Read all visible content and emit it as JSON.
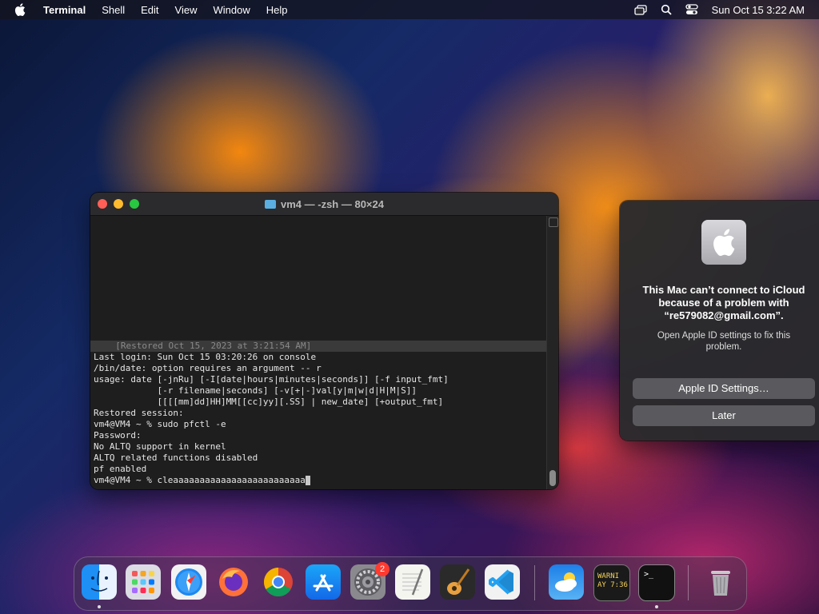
{
  "menubar": {
    "app_name": "Terminal",
    "items": [
      "Shell",
      "Edit",
      "View",
      "Window",
      "Help"
    ],
    "clock": "Sun Oct 15  3:22 AM"
  },
  "terminal": {
    "title": "vm4 — -zsh — 80×24",
    "lines": [
      "  [Restored Oct 15, 2023 at 3:21:54 AM]",
      "Last login: Sun Oct 15 03:20:26 on console",
      "/bin/date: option requires an argument -- r",
      "usage: date [-jnRu] [-I[date|hours|minutes|seconds]] [-f input_fmt]",
      "            [-r filename|seconds] [-v[+|-]val[y|m|w|d|H|M|S]]",
      "            [[[[mm]dd]HH]MM[[cc]yy][.SS] | new_date] [+output_fmt]",
      "Restored session:",
      "vm4@VM4 ~ % sudo pfctl -e",
      "Password:",
      "No ALTQ support in kernel",
      "ALTQ related functions disabled",
      "pf enabled"
    ],
    "prompt_line": "vm4@VM4 ~ % cleaaaaaaaaaaaaaaaaaaaaaaaaa"
  },
  "alert": {
    "title": "This Mac can’t connect to iCloud because of a problem with “re579082@gmail.com”.",
    "message": "Open Apple ID settings to fix this problem.",
    "primary_button": "Apple ID Settings…",
    "secondary_button": "Later"
  },
  "dock": {
    "items": [
      {
        "name": "finder-icon",
        "app": "Finder"
      },
      {
        "name": "launchpad-icon",
        "app": "Launchpad"
      },
      {
        "name": "safari-icon",
        "app": "Safari"
      },
      {
        "name": "firefox-icon",
        "app": "Firefox"
      },
      {
        "name": "chrome-icon",
        "app": "Chrome"
      },
      {
        "name": "app-store-icon",
        "app": "App Store"
      },
      {
        "name": "system-settings-icon",
        "app": "System Settings"
      },
      {
        "name": "textedit-icon",
        "app": "TextEdit"
      },
      {
        "name": "garageband-icon",
        "app": "GarageBand"
      },
      {
        "name": "vscode-icon",
        "app": "Visual Studio Code"
      },
      {
        "name": "weather-icon",
        "app": "Weather"
      },
      {
        "name": "console-icon",
        "app": "Console"
      },
      {
        "name": "terminal-icon",
        "app": "Terminal"
      },
      {
        "name": "trash-icon",
        "app": "Trash"
      }
    ],
    "settings_badge": "2",
    "console_text_1": "WARNI",
    "console_text_2": "AY 7:36",
    "terminal_prompt": ">_"
  },
  "colors": {
    "close": "#ff5f57",
    "minimize": "#febc2e",
    "zoom": "#28c840",
    "badge": "#ff3b30"
  }
}
